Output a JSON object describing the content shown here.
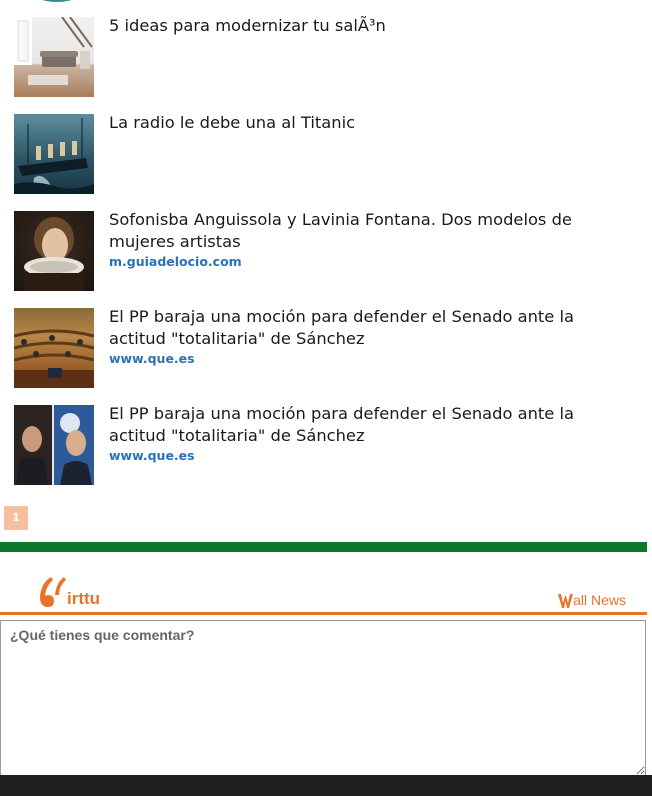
{
  "news": {
    "items": [
      {
        "title": "5 ideas para modernizar tu salÃ³n",
        "source": "",
        "thumb": "living-room-photo"
      },
      {
        "title": "La radio le debe una al Titanic",
        "source": "",
        "thumb": "titanic-ship-photo"
      },
      {
        "title": "Sofonisba Anguissola y Lavinia Fontana. Dos modelos de mujeres artistas",
        "source": "m.guiadelocio.com",
        "thumb": "renaissance-portrait-photo"
      },
      {
        "title": "El PP baraja una moción para defender el Senado ante la actitud \"totalitaria\" de Sánchez",
        "source": "www.que.es",
        "thumb": "senate-chamber-photo"
      },
      {
        "title": "El PP baraja una moción para defender el Senado ante la actitud \"totalitaria\" de Sánchez",
        "source": "www.que.es",
        "thumb": "politicians-photo"
      }
    ]
  },
  "pagination": {
    "current_page": "1"
  },
  "comments": {
    "brand_name": "irttu",
    "brand_icon": "quote-mark-icon",
    "wall_news_label": "all News",
    "wall_news_icon": "w-letter-icon",
    "placeholder": "¿Qué tienes que comentar?"
  },
  "colors": {
    "accent_orange": "#e8742a",
    "green_bar": "#0a7a2a",
    "source_link": "#2a72b5",
    "pager_bg": "#f6c0a0"
  }
}
